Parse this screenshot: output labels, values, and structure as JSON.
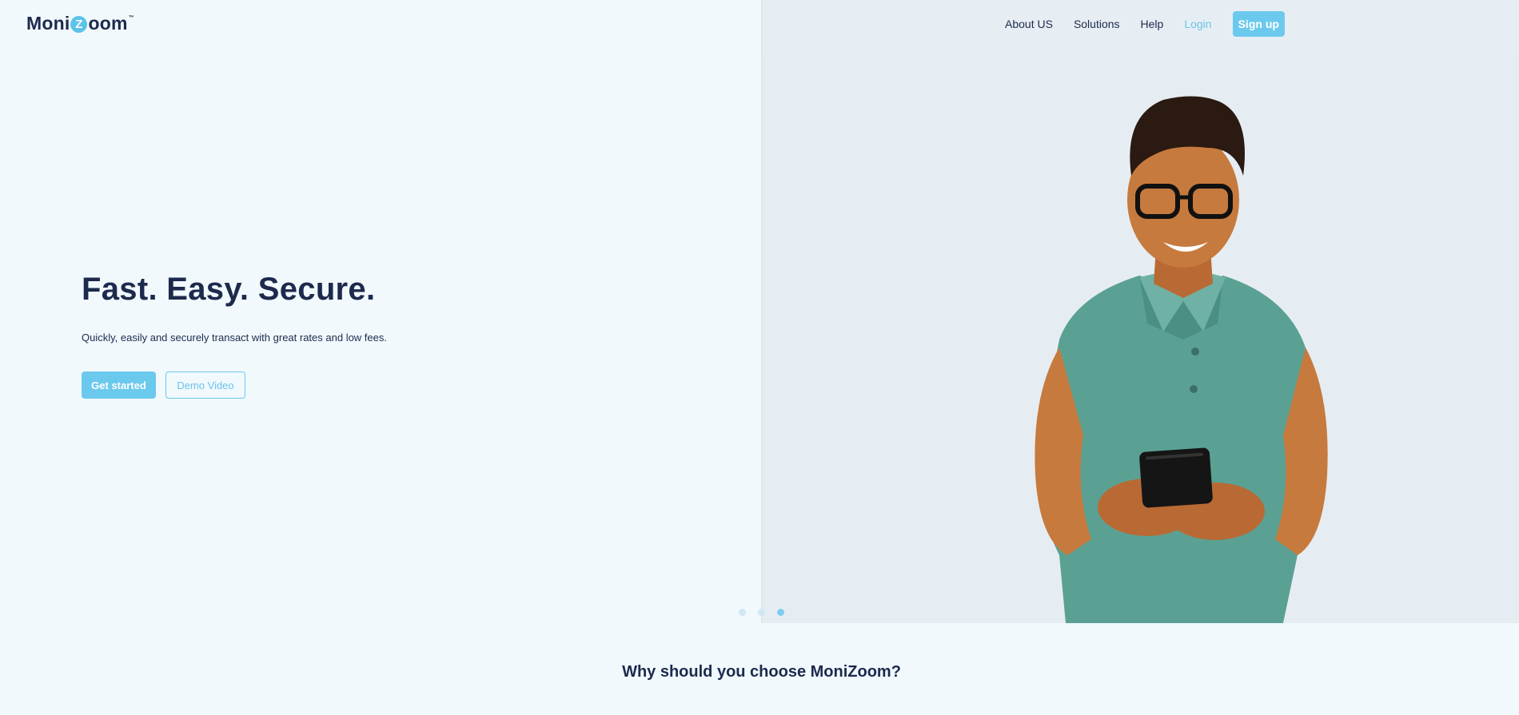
{
  "brand": {
    "name_part1": "Moni",
    "name_z": "Z",
    "name_part2": "oom",
    "trademark": "™",
    "accent_color": "#6cc9ee",
    "text_color": "#1d2a4d"
  },
  "nav": {
    "items": [
      {
        "label": "About US"
      },
      {
        "label": "Solutions"
      },
      {
        "label": "Help"
      }
    ],
    "login_label": "Login",
    "signup_label": "Sign up"
  },
  "hero": {
    "title": "Fast. Easy. Secure.",
    "subtitle": "Quickly, easily and securely transact with great rates and low fees.",
    "primary_cta": "Get started",
    "secondary_cta": "Demo Video",
    "image_icon": "person-with-phone-photo"
  },
  "carousel": {
    "total": 3,
    "active_index": 3
  },
  "section": {
    "title": "Why should you choose MoniZoom?"
  }
}
